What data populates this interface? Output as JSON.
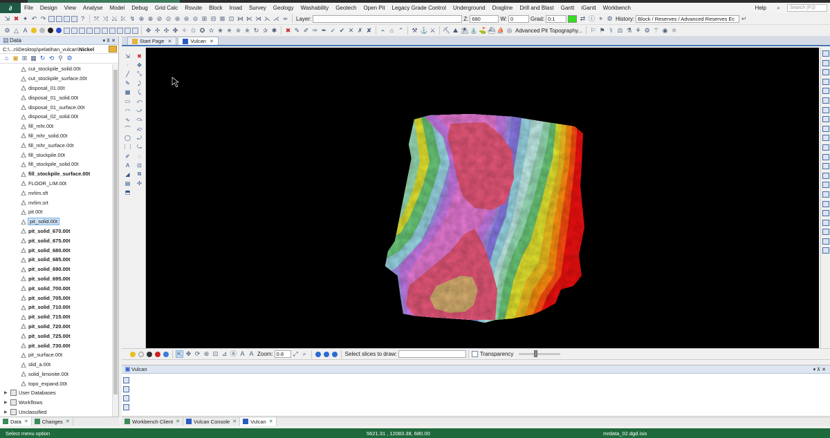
{
  "menu": [
    "File",
    "Design",
    "View",
    "Analyse",
    "Model",
    "Debug",
    "Grid Calc",
    "Rsvute",
    "Block",
    "Iroad",
    "Survey",
    "Geology",
    "Washability",
    "Geotech",
    "Open Pit",
    "Legacy Grade Control",
    "Underground",
    "Dragline",
    "Drill and Blast",
    "Gantt",
    "iGantt",
    "Workbench"
  ],
  "menu_right": {
    "help": "Help",
    "search_placeholder": "Search (F3)"
  },
  "toolbar1": {
    "layer_label": "Layer:",
    "layer_value": "",
    "z_label": "Z:",
    "z_value": "680",
    "w_label": "W:",
    "w_value": "0",
    "grad_label": "Grad:",
    "grad_value": "0:1",
    "grad_color": "#33dd22",
    "history_label": "History:",
    "history_value": "Block / Reserves / Advanced Reserves Ec"
  },
  "toolbar2": {
    "advanced_pit_label": "Advanced Pit Topography..."
  },
  "left_panel": {
    "title": "Data",
    "path": "C:\\...n\\Desktop\\pelatihan_vulcan\\",
    "path_bold": "Nickel",
    "items": [
      {
        "label": "cut_stockpile_solid.00t",
        "bold": false
      },
      {
        "label": "cut_stockpile_surface.00t",
        "bold": false
      },
      {
        "label": "disposal_01.00t",
        "bold": false
      },
      {
        "label": "disposal_01_solid.00t",
        "bold": false
      },
      {
        "label": "disposal_01_surface.00t",
        "bold": false
      },
      {
        "label": "disposal_02_solid.00t",
        "bold": false
      },
      {
        "label": "fill_mhr.00t",
        "bold": false
      },
      {
        "label": "fill_mhr_solid.00t",
        "bold": false
      },
      {
        "label": "fill_mhr_surface.00t",
        "bold": false
      },
      {
        "label": "fill_stockpile.00t",
        "bold": false
      },
      {
        "label": "fill_stockpile_solid.00t",
        "bold": false
      },
      {
        "label": "fill_stockpile_surface.00t",
        "bold": true
      },
      {
        "label": "FLOOR_LIM.00t",
        "bold": false
      },
      {
        "label": "mrlim.sft",
        "bold": false
      },
      {
        "label": "mrlim.srt",
        "bold": false
      },
      {
        "label": "pit.00t",
        "bold": false
      },
      {
        "label": "pit_solid.00t",
        "bold": false,
        "selected": true
      },
      {
        "label": "pit_solid_670.00t",
        "bold": true
      },
      {
        "label": "pit_solid_675.00t",
        "bold": true
      },
      {
        "label": "pit_solid_680.00t",
        "bold": true
      },
      {
        "label": "pit_solid_685.00t",
        "bold": true
      },
      {
        "label": "pit_solid_690.00t",
        "bold": true
      },
      {
        "label": "pit_solid_695.00t",
        "bold": true
      },
      {
        "label": "pit_solid_700.00t",
        "bold": true
      },
      {
        "label": "pit_solid_705.00t",
        "bold": true
      },
      {
        "label": "pit_solid_710.00t",
        "bold": true
      },
      {
        "label": "pit_solid_715.00t",
        "bold": true
      },
      {
        "label": "pit_solid_720.00t",
        "bold": true
      },
      {
        "label": "pit_solid_725.00t",
        "bold": true
      },
      {
        "label": "pit_solid_730.00t",
        "bold": true
      },
      {
        "label": "pit_surface.00t",
        "bold": false
      },
      {
        "label": "slid_a.00t",
        "bold": false
      },
      {
        "label": "solid_limonite.00t",
        "bold": false
      },
      {
        "label": "topo_expand.00t",
        "bold": false
      }
    ],
    "top_level": [
      "User Databases",
      "Workflows",
      "Unclassified"
    ],
    "tabs": [
      "Data",
      "Changes"
    ]
  },
  "doc_tabs": [
    "Start Page",
    "Vulcan"
  ],
  "view_bar": {
    "zoom_label": "Zoom:",
    "zoom_value": "0.8",
    "slices_label": "Select slices to draw:",
    "slices_value": "",
    "transparency_label": "Transparency"
  },
  "console": {
    "title": "Vulcan"
  },
  "bottom_tabs": [
    "Workbench Client",
    "Vulcan Console",
    "Vulcan"
  ],
  "status": {
    "message": "Select menu option",
    "coords": "5621.31 , 12083.38, 680.00",
    "file": "mrdata_02.dgd.isis"
  },
  "colors": {
    "status_bar": "#1e6a3c",
    "viewport_bg": "#000000",
    "contour_bands": [
      "#e8587a",
      "#e87ad6",
      "#c77ae8",
      "#a58ee8",
      "#8a7ae6",
      "#9ad8e6",
      "#c3eee8",
      "#9ae0b8",
      "#6ac878",
      "#e6e630",
      "#f0c020",
      "#ff9010",
      "#ff5010",
      "#f01010",
      "#d8b070"
    ]
  }
}
